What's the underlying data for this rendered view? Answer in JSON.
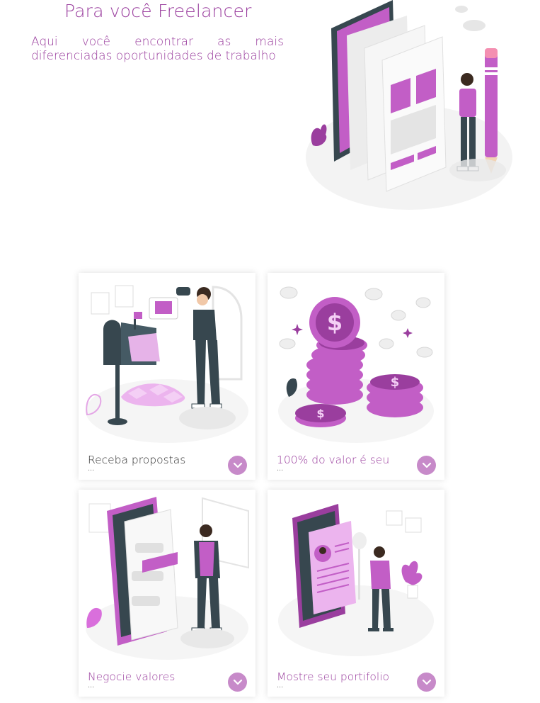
{
  "hero": {
    "title": "Para você Freelancer",
    "subtitle": "Aqui você encontrar as mais diferenciadas oportunidades de trabalho"
  },
  "cards": [
    {
      "label": "Receba propostas",
      "more": "...",
      "icon": "mailbox-illustration"
    },
    {
      "label": "100% do valor é seu",
      "more": "...",
      "icon": "coins-illustration"
    },
    {
      "label": "Negocie valores",
      "more": "...",
      "icon": "chat-negotiation-illustration"
    },
    {
      "label": "Mostre seu portifolio",
      "more": "...",
      "icon": "portfolio-illustration"
    }
  ],
  "colors": {
    "accent": "#9a3e9e",
    "light_accent": "#c78ac9",
    "illustration_pink": "#c25ec6",
    "illustration_dark": "#37474f"
  }
}
